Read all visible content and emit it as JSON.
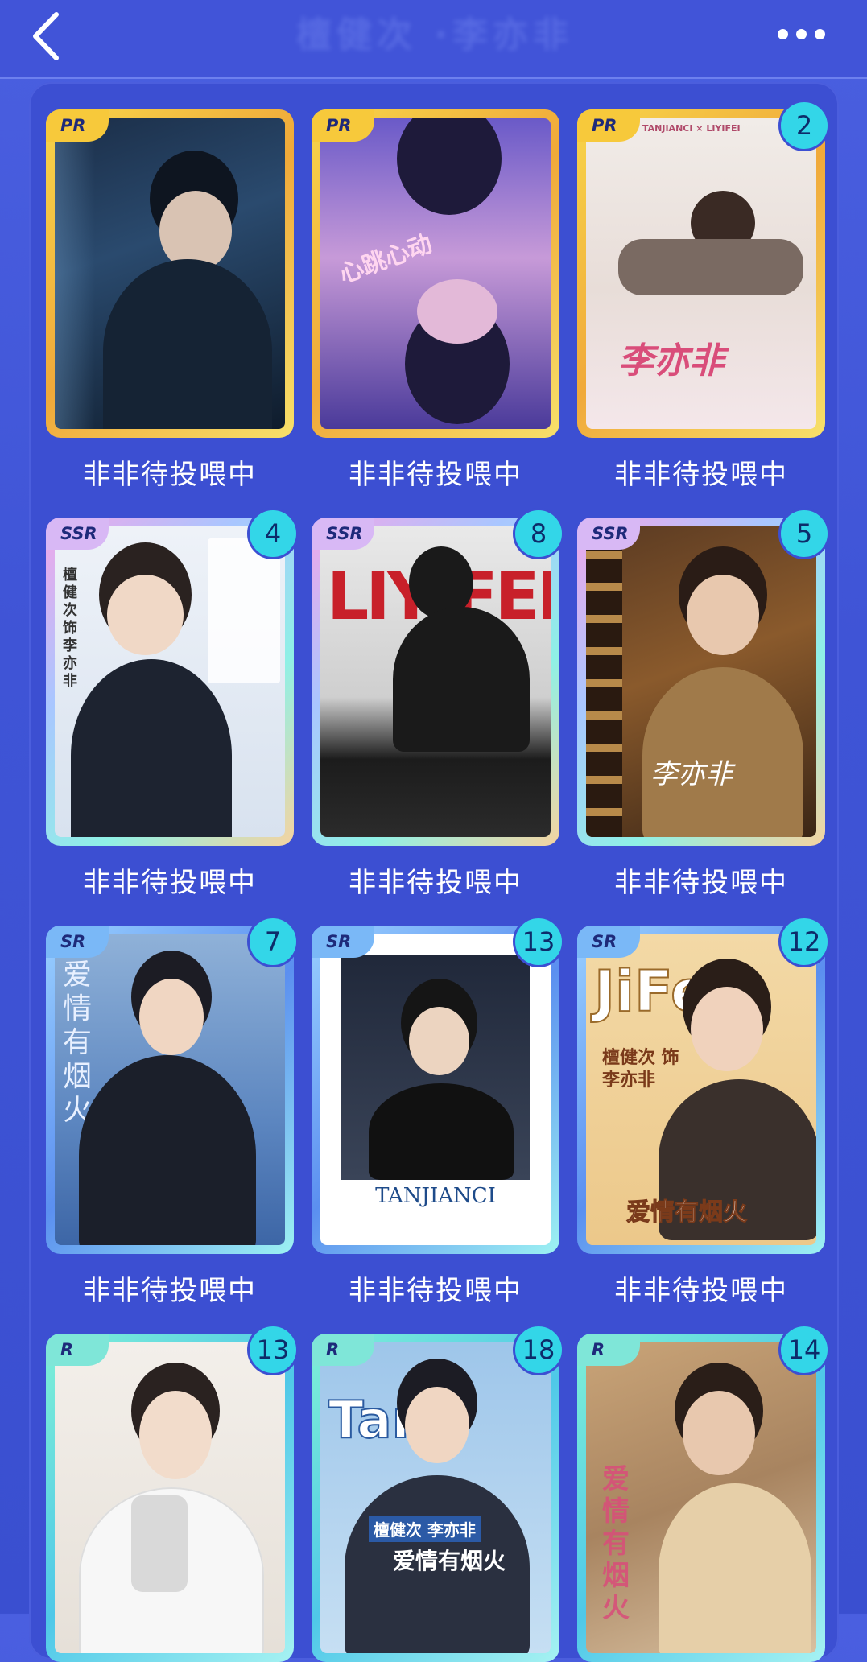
{
  "header": {
    "title": "檀健次 ·李亦非",
    "back_icon": "chevron-left-icon",
    "more_icon": "more-dots-icon"
  },
  "cards": [
    {
      "rarity": "PR",
      "count": "",
      "caption": "非非待投喂中"
    },
    {
      "rarity": "PR",
      "count": "",
      "caption": "非非待投喂中",
      "art_text": "心跳心动"
    },
    {
      "rarity": "PR",
      "count": "2",
      "caption": "非非待投喂中",
      "art_text": "李亦非",
      "art_top": "TANJIANCI × LIYIFEI"
    },
    {
      "rarity": "SSR",
      "count": "4",
      "caption": "非非待投喂中",
      "art_text": "檀健次 饰 李亦非"
    },
    {
      "rarity": "SSR",
      "count": "8",
      "caption": "非非待投喂中",
      "art_text": "LIYIFEI"
    },
    {
      "rarity": "SSR",
      "count": "5",
      "caption": "非非待投喂中",
      "art_text": "李亦非"
    },
    {
      "rarity": "SR",
      "count": "7",
      "caption": "非非待投喂中",
      "art_text": "爱情有烟火"
    },
    {
      "rarity": "SR",
      "count": "13",
      "caption": "非非待投喂中",
      "art_text": "TANJIANCI"
    },
    {
      "rarity": "SR",
      "count": "12",
      "caption": "非非待投喂中",
      "art_text": "爱情有烟火",
      "art_top": "檀健次 饰 李亦非"
    },
    {
      "rarity": "R",
      "count": "13",
      "caption": ""
    },
    {
      "rarity": "R",
      "count": "18",
      "caption": "",
      "art_text": "爱情有烟火",
      "art_top": "檀健次 李亦非"
    },
    {
      "rarity": "R",
      "count": "14",
      "caption": "",
      "art_text": "爱情有烟火"
    }
  ],
  "colors": {
    "PR": "#f5c23a",
    "SSR": "#c8a6f5",
    "SR": "#6fb2f5",
    "R": "#4fd6c8",
    "badge": "#33d6e8"
  }
}
